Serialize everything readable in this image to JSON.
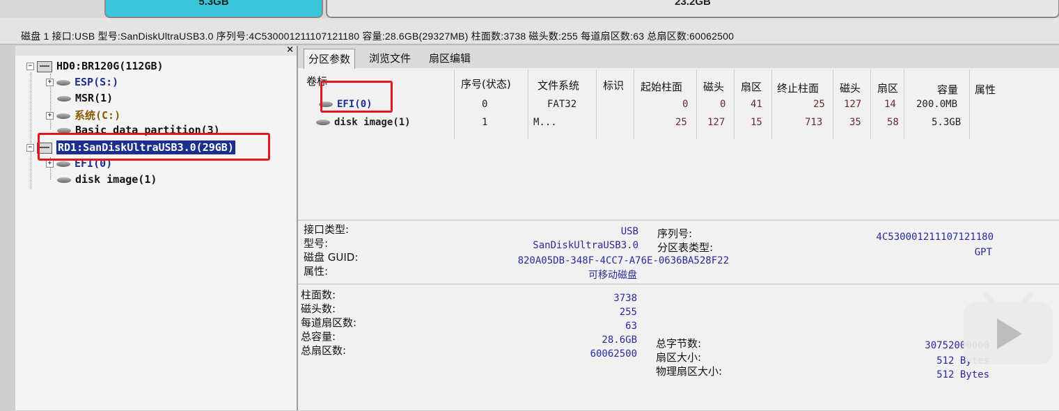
{
  "partition_bar": {
    "part1_size": "5.3GB",
    "part2_size": "23.2GB",
    "part1_color": "#39c6d9"
  },
  "disk_info_line": "磁盘 1 接口:USB  型号:SanDiskUltraUSB3.0  序列号:4C530001211107121180  容量:28.6GB(29327MB)  柱面数:3738  磁头数:255  每道扇区数:63  总扇区数:60062500",
  "tree": {
    "close": "×",
    "hd0": "HD0:BR120G(112GB)",
    "hd0_children": [
      "ESP(S:)",
      "MSR(1)",
      "系统(C:)",
      "Basic data partition(3)"
    ],
    "rd1": "RD1:SanDiskUltraUSB3.0(29GB)",
    "rd1_children": [
      "EFI(0)",
      "disk image(1)"
    ]
  },
  "tabs": [
    "分区参数",
    "浏览文件",
    "扇区编辑"
  ],
  "table": {
    "headers": [
      "卷标",
      "序号(状态)",
      "文件系统",
      "标识",
      "起始柱面",
      "磁头",
      "扇区",
      "终止柱面",
      "磁头",
      "扇区",
      "容量",
      "属性"
    ],
    "rows": [
      [
        "EFI(0)",
        "0",
        "FAT32",
        "",
        "0",
        "0",
        "41",
        "25",
        "127",
        "14",
        "200.0MB",
        ""
      ],
      [
        "disk image(1)",
        "1",
        "M...",
        "",
        "25",
        "127",
        "15",
        "713",
        "35",
        "58",
        "5.3GB",
        ""
      ]
    ]
  },
  "disk_props": {
    "labels": [
      "接口类型:",
      "型号:",
      "磁盘 GUID:",
      "属性:"
    ],
    "values": [
      "USB",
      "SanDiskUltraUSB3.0",
      "820A05DB-348F-4CC7-A76E-0636BA528F22",
      "可移动磁盘"
    ],
    "serial_label": "序列号:",
    "serial_value": "4C530001211107121180",
    "ptable_label": "分区表类型:",
    "ptable_value": "GPT"
  },
  "geometry": {
    "labels": [
      "柱面数:",
      "磁头数:",
      "每道扇区数:",
      "总容量:",
      "总扇区数:"
    ],
    "values": [
      "3738",
      "255",
      "63",
      "28.6GB",
      "60062500"
    ],
    "right_labels": [
      "总字节数:",
      "扇区大小:",
      "物理扇区大小:"
    ],
    "right_values": [
      "30752000000",
      "512 Bytes",
      "512 Bytes"
    ]
  },
  "accent_selection": "#1c2f8c",
  "highlight_color": "#e3161c"
}
